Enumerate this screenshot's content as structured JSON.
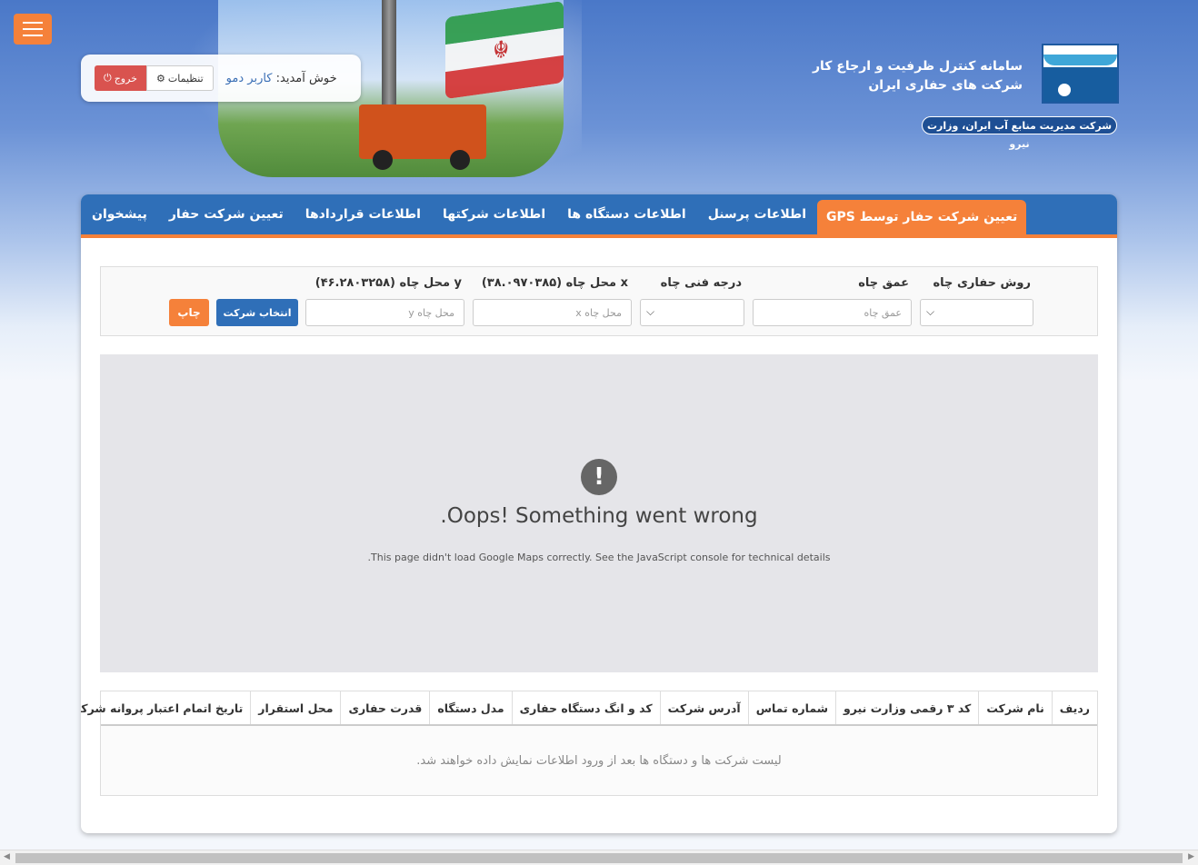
{
  "header": {
    "menu_label": "",
    "brand_title_line1": "سامانه کنترل ظرفیت و ارجاع کار",
    "brand_title_line2": "شرکت های حفاری ایران",
    "brand_subtitle": "شرکت مدیریت منابع آب ایران، وزارت نیرو",
    "welcome_prefix": "خوش آمدید:",
    "user_name": "کاربر دمو",
    "settings_label": "تنظیمات",
    "exit_label": "خروج"
  },
  "nav": {
    "items": [
      {
        "label": "پیشخوان"
      },
      {
        "label": "تعیین شرکت حفار"
      },
      {
        "label": "اطلاعات قراردادها"
      },
      {
        "label": "اطلاعات شرکتها"
      },
      {
        "label": "اطلاعات دستگاه ها"
      },
      {
        "label": "اطلاعات پرسنل"
      },
      {
        "label": "تعیین شرکت حفار توسط GPS"
      }
    ],
    "active_index": 6
  },
  "filters": {
    "method_label": "روش حفاری چاه",
    "depth_label": "عمق چاه",
    "depth_placeholder": "عمق چاه",
    "grade_label": "درجه فنی چاه",
    "x_label": "x محل چاه (۳۸.۰۹۷۰۳۸۵)",
    "x_placeholder": "محل چاه x",
    "y_label": "y محل چاه (۴۶.۲۸۰۳۲۵۸)",
    "y_placeholder": "محل چاه y",
    "select_button": "انتخاب شرکت",
    "print_button": "چاپ"
  },
  "map": {
    "error_icon": "!",
    "error_title": ".Oops! Something went wrong",
    "error_message": ".This page didn't load Google Maps correctly. See the JavaScript console for technical details"
  },
  "table": {
    "headers": [
      "ردیف",
      "نام شرکت",
      "کد ۳ رقمی وزارت نیرو",
      "شماره تماس",
      "آدرس شرکت",
      "کد و انگ دستگاه حفاری",
      "مدل دستگاه",
      "قدرت حفاری",
      "محل استقرار",
      "تاریخ اتمام اعتبار پروانه شرکت"
    ],
    "empty_message": "لیست شرکت ها و دستگاه ها بعد از ورود اطلاعات نمایش داده خواهند شد."
  },
  "colors": {
    "accent": "#f5813a",
    "primary": "#2f6fb8",
    "danger": "#d9534f"
  }
}
